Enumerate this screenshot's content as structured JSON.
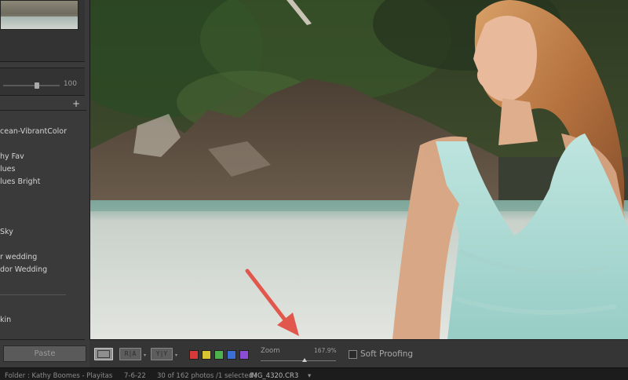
{
  "left_panel": {
    "slider": {
      "value_label": "100",
      "fraction": 0.55
    },
    "add_symbol": "+",
    "presets": [
      {
        "label": "cean-VibrantColor"
      },
      {
        "label": "hy Fav"
      },
      {
        "label": "lues"
      },
      {
        "label": "lues Bright"
      },
      {
        "label": " Sky"
      },
      {
        "label": "r wedding"
      },
      {
        "label": "dor Wedding"
      },
      {
        "label": "kin"
      }
    ],
    "paste_label": "Paste"
  },
  "toolbar": {
    "view_compare_label": "R|A",
    "view_survey_label": "Y|Y",
    "dropdown_glyph": "▾",
    "color_labels": [
      "#d83a3a",
      "#d8c430",
      "#4eb24e",
      "#3c6fd6",
      "#8b4cd6"
    ],
    "zoom": {
      "label": "Zoom",
      "value": "167.9%",
      "fraction": 0.58
    },
    "soft_proofing_label": "Soft Proofing"
  },
  "status_bar": {
    "folder": "Folder : Kathy Boomes - Playitas",
    "date": "7-6-22",
    "count": "30 of 162 photos /1 selected /",
    "filename": "IMG_4320.CR3",
    "dropdown_glyph": "▾"
  },
  "colors": {
    "panel_bg": "#3a3a3a",
    "toolbar_bg": "#353535",
    "annotation_arrow": "#e2574c"
  }
}
